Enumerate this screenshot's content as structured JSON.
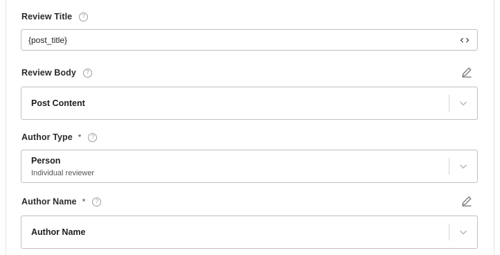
{
  "review_title": {
    "label": "Review Title",
    "value": "{post_title}"
  },
  "review_body": {
    "label": "Review Body",
    "selected": "Post Content"
  },
  "author_type": {
    "label": "Author Type",
    "required_mark": "*",
    "selected": "Person",
    "selected_description": "Individual reviewer"
  },
  "author_name": {
    "label": "Author Name",
    "required_mark": "*",
    "selected": "Author Name"
  },
  "icons": {
    "help": "question-circle-icon",
    "edit": "pencil-icon",
    "code": "code-brackets-icon",
    "dropdown": "chevron-down-icon"
  },
  "colors": {
    "border": "#bfbfbf",
    "icon": "#7a7a7a"
  }
}
